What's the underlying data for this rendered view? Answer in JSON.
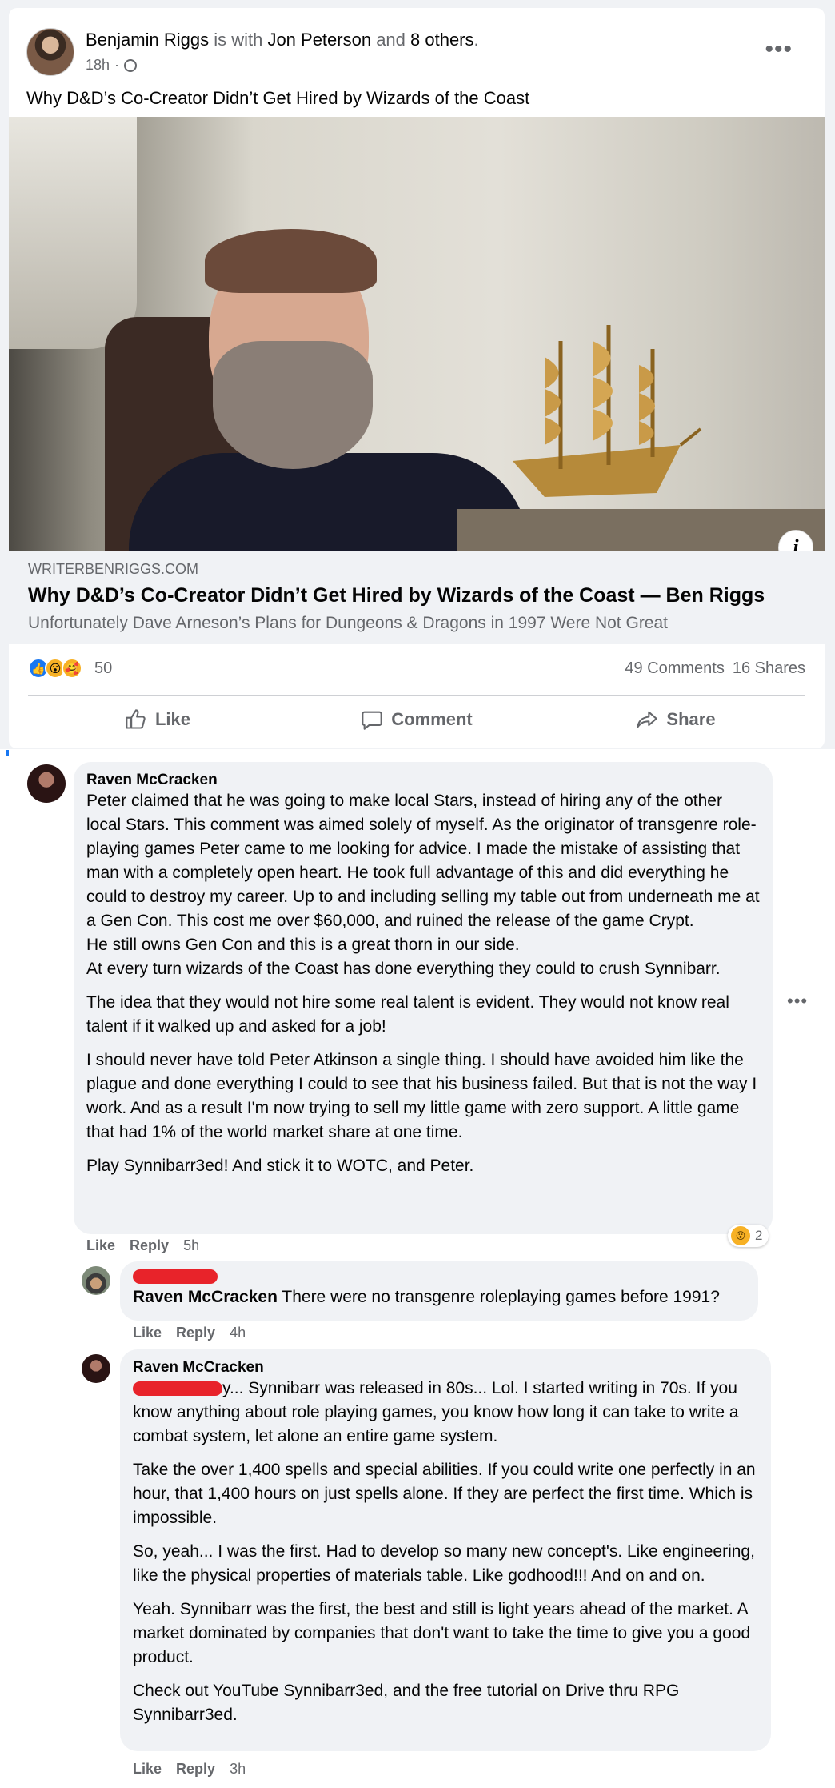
{
  "post": {
    "author": "Benjamin Riggs",
    "with_text": " is with ",
    "tagged": "Jon Peterson",
    "and_text": " and ",
    "others": "8 others",
    "period": ".",
    "time": "18h",
    "dot": "·",
    "visibility_icon": "globe-icon",
    "more_icon": "more-dots-icon",
    "text": "Why D&D’s Co-Creator Didn’t Get Hired by Wizards of the Coast"
  },
  "link_preview": {
    "domain": "WRITERBENRIGGS.COM",
    "title": "Why D&D’s Co-Creator Didn’t Get Hired by Wizards of the Coast — Ben Riggs",
    "subtitle": "Unfortunately Dave Arneson’s Plans for Dungeons & Dragons in 1997 Were Not Great",
    "info_icon": "info-icon"
  },
  "stats": {
    "reactions": [
      "like",
      "wow",
      "care"
    ],
    "reaction_count": "50",
    "comments": "49 Comments",
    "shares": "16 Shares"
  },
  "actions": {
    "like": "Like",
    "comment": "Comment",
    "share": "Share"
  },
  "comments": [
    {
      "name": "Raven McCracken",
      "paragraphs": [
        "Peter claimed that he was going to make local Stars, instead of hiring any of the other local Stars. This comment was aimed solely of myself. As the originator of transgenre role-playing games Peter came to me looking for advice. I made the mistake of assisting that man with a completely open heart. He took full advantage of this and did everything he could to destroy my career. Up to and including selling my table out from underneath me at a Gen Con. This cost me over $60,000, and ruined the release of the game Crypt.",
        "He still owns Gen Con and this is a great thorn in our side.",
        "At every turn wizards of the Coast has done everything they could to crush Synnibarr.",
        "The idea that they would not hire some real talent is evident. They would not know real talent if it walked up and asked for a job!",
        "I should never have told Peter Atkinson a single thing. I should have avoided him like the plague and done everything I could to see that his business failed. But that is not the way I work. And as a result I'm now trying to sell my little game with zero support. A little game that had 1% of the world market share at one time.",
        "Play Synnibarr3ed! And stick it to WOTC, and Peter."
      ],
      "like": "Like",
      "reply": "Reply",
      "time": "5h",
      "reaction_count": "2"
    },
    {
      "mention": "Raven McCracken",
      "text": " There were no transgenre roleplaying games before 1991?",
      "like": "Like",
      "reply": "Reply",
      "time": "4h"
    },
    {
      "name": "Raven McCracken",
      "paragraphs": [
        "y... Synnibarr was released in 80s... Lol. I started writing in 70s. If you know anything about role playing games, you know how long it can take to write a combat system, let alone an entire game system.",
        "Take the over 1,400 spells and special abilities. If you could write one perfectly in an hour, that 1,400 hours on just spells alone. If they are perfect the first time. Which is impossible.",
        "So, yeah... I was the first. Had to develop so many new concept's. Like engineering, like the physical properties of materials table. Like godhood!!! And on and on.",
        "Yeah. Synnibarr was the first, the best and still is light years ahead of the market. A market dominated by companies that don't want to take the time to give you a good product.",
        "Check out YouTube Synnibarr3ed, and the free tutorial on Drive thru RPG Synnibarr3ed."
      ],
      "like": "Like",
      "reply": "Reply",
      "time": "3h"
    }
  ],
  "colors": {
    "facebook_blue": "#1877f2",
    "secondary_text": "#65676b",
    "bubble_bg": "#f0f2f5",
    "redaction": "#e8232a"
  }
}
